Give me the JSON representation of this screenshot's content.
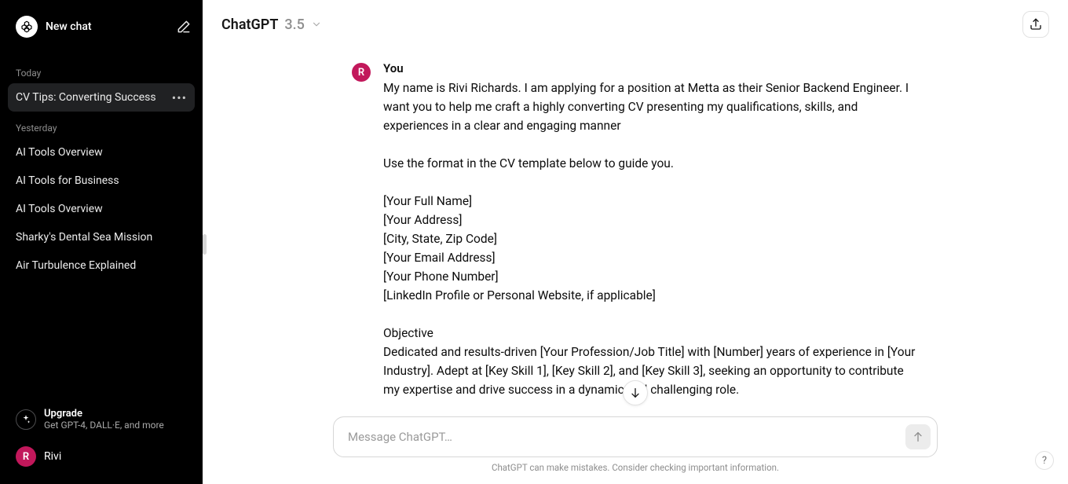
{
  "sidebar": {
    "new_chat_label": "New chat",
    "groups": [
      {
        "label": "Today",
        "items": [
          {
            "label": "CV Tips: Converting Success",
            "active": true
          }
        ]
      },
      {
        "label": "Yesterday",
        "items": [
          {
            "label": "AI Tools Overview"
          },
          {
            "label": "AI Tools for Business"
          },
          {
            "label": "AI Tools Overview"
          },
          {
            "label": "Sharky's Dental Sea Mission"
          },
          {
            "label": "Air Turbulence Explained"
          }
        ]
      }
    ],
    "upgrade": {
      "title": "Upgrade",
      "sub": "Get GPT-4, DALL·E, and more"
    },
    "user": {
      "initial": "R",
      "name": "Rivi"
    }
  },
  "header": {
    "model_name": "ChatGPT",
    "model_version": "3.5"
  },
  "messages": [
    {
      "author": "You",
      "avatar_initial": "R",
      "text": "My name is Rivi Richards. I am applying for a position at Metta as their Senior Backend Engineer.  I want you to help me craft a highly converting CV  presenting my qualifications, skills, and experiences in a clear and engaging manner\n\nUse the format in the CV template below to guide you.\n\n[Your Full Name]\n[Your Address]\n[City, State, Zip Code]\n[Your Email Address]\n[Your Phone Number]\n[LinkedIn Profile or Personal Website, if applicable]\n\nObjective\nDedicated and results-driven [Your Profession/Job Title] with [Number] years of experience in [Your Industry]. Adept at [Key Skill 1], [Key Skill 2], and [Key Skill 3], seeking an opportunity to contribute my expertise and drive success in a dynamic and challenging role."
    }
  ],
  "input": {
    "placeholder": "Message ChatGPT…",
    "value": ""
  },
  "footer_note": "ChatGPT can make mistakes. Consider checking important information.",
  "help_label": "?"
}
